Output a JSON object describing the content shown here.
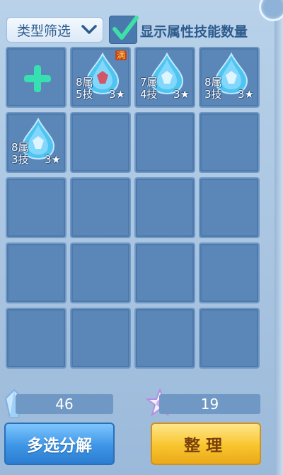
{
  "filter": {
    "label": "类型筛选"
  },
  "show_attr": {
    "checked": true,
    "label": "显示属性技能数量"
  },
  "slots": [
    {
      "type": "add"
    },
    {
      "type": "gem",
      "gem_color": "red",
      "attr": "8属",
      "skill": "5技",
      "star": "3★",
      "badge": "满"
    },
    {
      "type": "gem",
      "gem_color": "blue",
      "attr": "7属",
      "skill": "4技",
      "star": "3★",
      "badge": ""
    },
    {
      "type": "gem",
      "gem_color": "blue",
      "attr": "8属",
      "skill": "3技",
      "star": "3★",
      "badge": ""
    },
    {
      "type": "gem",
      "gem_color": "blue",
      "attr": "8属",
      "skill": "3技",
      "star": "3★",
      "badge": ""
    },
    {
      "type": "empty"
    },
    {
      "type": "empty"
    },
    {
      "type": "empty"
    },
    {
      "type": "empty"
    },
    {
      "type": "empty"
    },
    {
      "type": "empty"
    },
    {
      "type": "empty"
    },
    {
      "type": "empty"
    },
    {
      "type": "empty"
    },
    {
      "type": "empty"
    },
    {
      "type": "empty"
    },
    {
      "type": "empty"
    },
    {
      "type": "empty"
    },
    {
      "type": "empty"
    },
    {
      "type": "empty"
    }
  ],
  "resources": {
    "crystal_count": "46",
    "star_count": "19"
  },
  "buttons": {
    "decompose": "多选分解",
    "arrange": "整理"
  },
  "colors": {
    "panel_bg": "#a7c3e0",
    "slot_bg": "#5b87b8",
    "accent_green": "#2fd49a",
    "button_blue": "#3e95e6",
    "button_gold": "#f8c52e"
  }
}
